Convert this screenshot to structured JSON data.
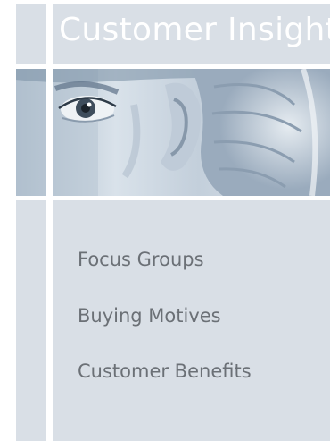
{
  "header": {
    "title": "Customer Insight"
  },
  "banner": {
    "image": "listening-face-photo"
  },
  "menu": {
    "items": [
      {
        "label": "Focus Groups"
      },
      {
        "label": "Buying Motives"
      },
      {
        "label": "Customer Benefits"
      }
    ]
  },
  "colors": {
    "panel": "#d9dfe6",
    "text": "#6b7076",
    "title": "#ffffff"
  }
}
